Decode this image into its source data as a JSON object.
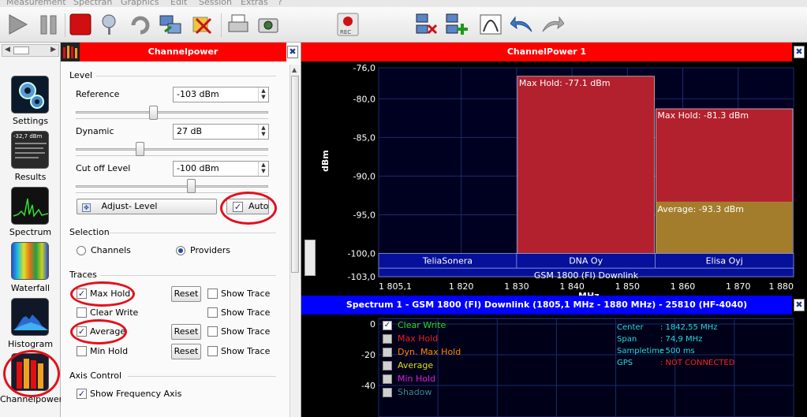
{
  "menu": [
    "Measurement",
    "Spectran",
    "Graphics",
    "Edit",
    "Session",
    "Extras",
    "?"
  ],
  "nav": [
    {
      "id": "settings",
      "label": "Settings"
    },
    {
      "id": "results",
      "label": "Results",
      "readout": "-32,7 dBm"
    },
    {
      "id": "spectrum",
      "label": "Spectrum"
    },
    {
      "id": "waterfall",
      "label": "Waterfall"
    },
    {
      "id": "histogram",
      "label": "Histogram"
    },
    {
      "id": "channelpower",
      "label": "Channelpower"
    }
  ],
  "record_label": "REC",
  "panel": {
    "title": "Channelpower",
    "level": {
      "heading": "Level",
      "reference_label": "Reference",
      "reference_value": "-103 dBm",
      "reference_level": 0.4,
      "dynamic_label": "Dynamic",
      "dynamic_value": "27 dB",
      "dynamic_level": 0.33,
      "cutoff_label": "Cut off Level",
      "cutoff_value": "-100 dBm",
      "cutoff_level": 0.6,
      "adjust_label": "Adjust- Level",
      "auto_label": "Auto",
      "auto_checked": true
    },
    "selection": {
      "heading": "Selection",
      "channels_label": "Channels",
      "providers_label": "Providers",
      "selected": "Providers"
    },
    "traces": {
      "heading": "Traces",
      "items": [
        {
          "label": "Max Hold",
          "checked": true,
          "reset": "Reset",
          "show": "Show Trace"
        },
        {
          "label": "Clear Write",
          "checked": false,
          "reset": "",
          "show": "Show Trace"
        },
        {
          "label": "Average",
          "checked": true,
          "reset": "Reset",
          "show": "Show Trace"
        },
        {
          "label": "Min Hold",
          "checked": false,
          "reset": "Reset",
          "show": "Show Trace"
        }
      ]
    },
    "axis": {
      "heading": "Axis Control",
      "show_freq_label": "Show Frequency Axis",
      "show_freq_checked": true
    }
  },
  "chart_title": "ChannelPower 1",
  "chart_data": {
    "type": "bar",
    "xlabel": "MHz",
    "ylabel": "dBm",
    "xlim": [
      1805.1,
      1880
    ],
    "ylim": [
      -103,
      -76
    ],
    "yticks": [
      "-76,0",
      "-80,0",
      "-85,0",
      "-90,0",
      "-95,0",
      "-100,0",
      "-103,0"
    ],
    "ytick_values": [
      -76,
      -80,
      -85,
      -90,
      -95,
      -100,
      -103
    ],
    "xticks": [
      "1 805,1",
      "1 820",
      "1 830",
      "1 840",
      "1 850",
      "1 860",
      "1 870",
      "1 880"
    ],
    "xtick_values": [
      1805.1,
      1820,
      1830,
      1840,
      1850,
      1860,
      1870,
      1880
    ],
    "providers": [
      {
        "name": "TeliaSonera",
        "from": 1805.1,
        "to": 1830.0,
        "max_hold": null,
        "average": null
      },
      {
        "name": "DNA Oy",
        "from": 1830.0,
        "to": 1855.0,
        "max_hold": -77.1,
        "max_hold_label": "Max Hold: -77.1 dBm",
        "average": null
      },
      {
        "name": "Elisa Oyj",
        "from": 1855.0,
        "to": 1880.0,
        "max_hold": -81.3,
        "max_hold_label": "Max Hold: -81.3 dBm",
        "average": -93.3,
        "average_label": "Average: -93.3 dBm"
      }
    ],
    "band_label": "GSM 1800 (FI) Downlink",
    "colors": {
      "max_hold": "#b3202e",
      "average": "#a47d2c",
      "provider_bar": "#06109a"
    }
  },
  "spectrum": {
    "title": "Spectrum 1 - GSM 1800 (FI) Downlink (1805,1 MHz - 1880 MHz) - 25810 (HF-4040)",
    "yticks": [
      "0",
      "-20",
      "-40"
    ],
    "legend": [
      {
        "label": "Clear Write",
        "checked": true,
        "color": "#22dd22"
      },
      {
        "label": "Max Hold",
        "checked": false,
        "color": "#ee2222"
      },
      {
        "label": "Dyn. Max Hold",
        "checked": false,
        "color": "#ff8800"
      },
      {
        "label": "Average",
        "checked": false,
        "color": "#dddd22"
      },
      {
        "label": "Min Hold",
        "checked": false,
        "color": "#dd22dd"
      },
      {
        "label": "Shadow",
        "checked": false,
        "color": "#3a8a8a"
      }
    ],
    "info": [
      {
        "k": "Center",
        "v": ": 1842,55 MHz",
        "color": "#22dddd"
      },
      {
        "k": "Span",
        "v": ": 74,9 MHz",
        "color": "#22dddd"
      },
      {
        "k": "Sampletime",
        "v": ": 500 ms",
        "color": "#22dddd"
      },
      {
        "k": "GPS",
        "v": ": NOT CONNECTED",
        "color": "#ff2020"
      }
    ]
  }
}
